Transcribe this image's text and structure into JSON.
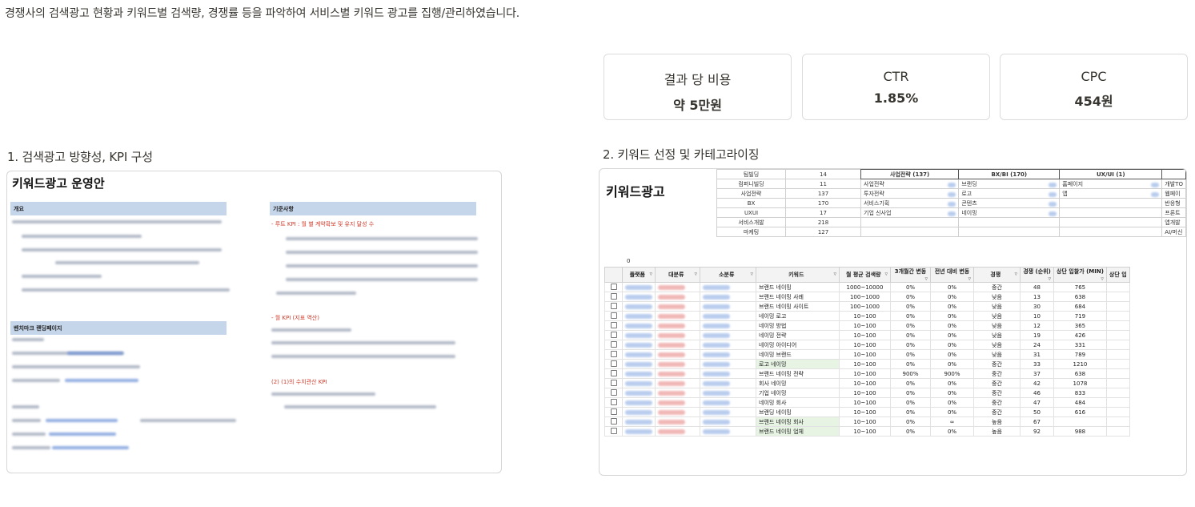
{
  "intro": "경쟁사의 검색광고 현황과 키워드별 검색량, 경쟁률 등을 파악하여 서비스별 키워드 광고를 집행/관리하였습니다.",
  "kpis": [
    {
      "label": "결과 당 비용",
      "value": "약 5만원"
    },
    {
      "label": "CTR",
      "value": "1.85%"
    },
    {
      "label": "CPC",
      "value": "454원"
    }
  ],
  "section1": {
    "title": "1. 검색광고 방향성, KPI 구성",
    "doc_title": "키워드광고 운영안",
    "bar_overview": "개요",
    "bar_benchmark": "벤치마크 랜딩페이지",
    "bar_criteria": "기준사항",
    "red_items": [
      "- 루트 KPI : 월 별 계약확보 및 유지 달성 수",
      "- 월 KPI (지표 역산)",
      "(2) (1)의 수치관산 KPI"
    ]
  },
  "section2": {
    "title": "2. 키워드 선정 및 카테고라이징",
    "sheet_title": "키워드광고",
    "counts": [
      {
        "name": "팀빌딩",
        "value": "14"
      },
      {
        "name": "컴퍼니빌딩",
        "value": "11"
      },
      {
        "name": "사업전략",
        "value": "137"
      },
      {
        "name": "BX",
        "value": "170"
      },
      {
        "name": "UXUI",
        "value": "17"
      },
      {
        "name": "서비스개발",
        "value": "218"
      },
      {
        "name": "마케팅",
        "value": "127"
      }
    ],
    "summary_headers": [
      "사업전략 (137)",
      "BX/BI (170)",
      "UX/UI (1)"
    ],
    "summary_col1": [
      "사업전략",
      "투자전략",
      "서비스기획",
      "기업 신사업"
    ],
    "summary_col2": [
      "브랜딩",
      "로고",
      "콘텐츠",
      "네이밍"
    ],
    "summary_col3": [
      "홈페이지",
      "앱"
    ],
    "summary_col4": [
      "개발TO",
      "웹페이",
      "반응형",
      "프론트",
      "앱개발",
      "AI/머신"
    ],
    "zero_label": "0",
    "columns": [
      "플랫폼",
      "대분류",
      "소분류",
      "키워드",
      "월 평균 검색량",
      "3개월간 변동",
      "전년 대비 변동",
      "경쟁",
      "경쟁 (순위)",
      "상단 입찰가 (MIN)",
      "상단 입"
    ],
    "rows": [
      {
        "kw": "브랜드 네이밍",
        "vol": "1000~10000",
        "m3": "0%",
        "yoy": "0%",
        "comp": "중간",
        "rank": "48",
        "bid": "765"
      },
      {
        "kw": "브랜드 네이밍 사례",
        "vol": "100~1000",
        "m3": "0%",
        "yoy": "0%",
        "comp": "낮음",
        "rank": "13",
        "bid": "638"
      },
      {
        "kw": "브랜드 네이밍 사이트",
        "vol": "100~1000",
        "m3": "0%",
        "yoy": "0%",
        "comp": "낮음",
        "rank": "30",
        "bid": "684"
      },
      {
        "kw": "네이밍 로고",
        "vol": "10~100",
        "m3": "0%",
        "yoy": "0%",
        "comp": "낮음",
        "rank": "10",
        "bid": "719"
      },
      {
        "kw": "네이밍 방법",
        "vol": "10~100",
        "m3": "0%",
        "yoy": "0%",
        "comp": "낮음",
        "rank": "12",
        "bid": "365"
      },
      {
        "kw": "네이밍 전략",
        "vol": "10~100",
        "m3": "0%",
        "yoy": "0%",
        "comp": "낮음",
        "rank": "19",
        "bid": "426"
      },
      {
        "kw": "네이밍 아이디어",
        "vol": "10~100",
        "m3": "0%",
        "yoy": "0%",
        "comp": "낮음",
        "rank": "24",
        "bid": "331"
      },
      {
        "kw": "네이밍 브랜드",
        "vol": "10~100",
        "m3": "0%",
        "yoy": "0%",
        "comp": "낮음",
        "rank": "31",
        "bid": "789"
      },
      {
        "kw": "로고 네이밍",
        "vol": "10~100",
        "m3": "0%",
        "yoy": "0%",
        "comp": "중간",
        "rank": "33",
        "bid": "1210"
      },
      {
        "kw": "브랜드 네이밍 전략",
        "vol": "10~100",
        "m3": "900%",
        "yoy": "900%",
        "comp": "중간",
        "rank": "37",
        "bid": "638"
      },
      {
        "kw": "회사 네이밍",
        "vol": "10~100",
        "m3": "0%",
        "yoy": "0%",
        "comp": "중간",
        "rank": "42",
        "bid": "1078"
      },
      {
        "kw": "기업 네이밍",
        "vol": "10~100",
        "m3": "0%",
        "yoy": "0%",
        "comp": "중간",
        "rank": "46",
        "bid": "833"
      },
      {
        "kw": "네이밍 회사",
        "vol": "10~100",
        "m3": "0%",
        "yoy": "0%",
        "comp": "중간",
        "rank": "47",
        "bid": "484"
      },
      {
        "kw": "브랜딩 네이밍",
        "vol": "10~100",
        "m3": "0%",
        "yoy": "0%",
        "comp": "중간",
        "rank": "50",
        "bid": "616"
      },
      {
        "kw": "브랜드 네이밍 회사",
        "vol": "10~100",
        "m3": "0%",
        "yoy": "∞",
        "comp": "높음",
        "rank": "67",
        "bid": ""
      },
      {
        "kw": "브랜드 네이밍 업체",
        "vol": "10~100",
        "m3": "0%",
        "yoy": "0%",
        "comp": "높음",
        "rank": "92",
        "bid": "988"
      }
    ]
  }
}
